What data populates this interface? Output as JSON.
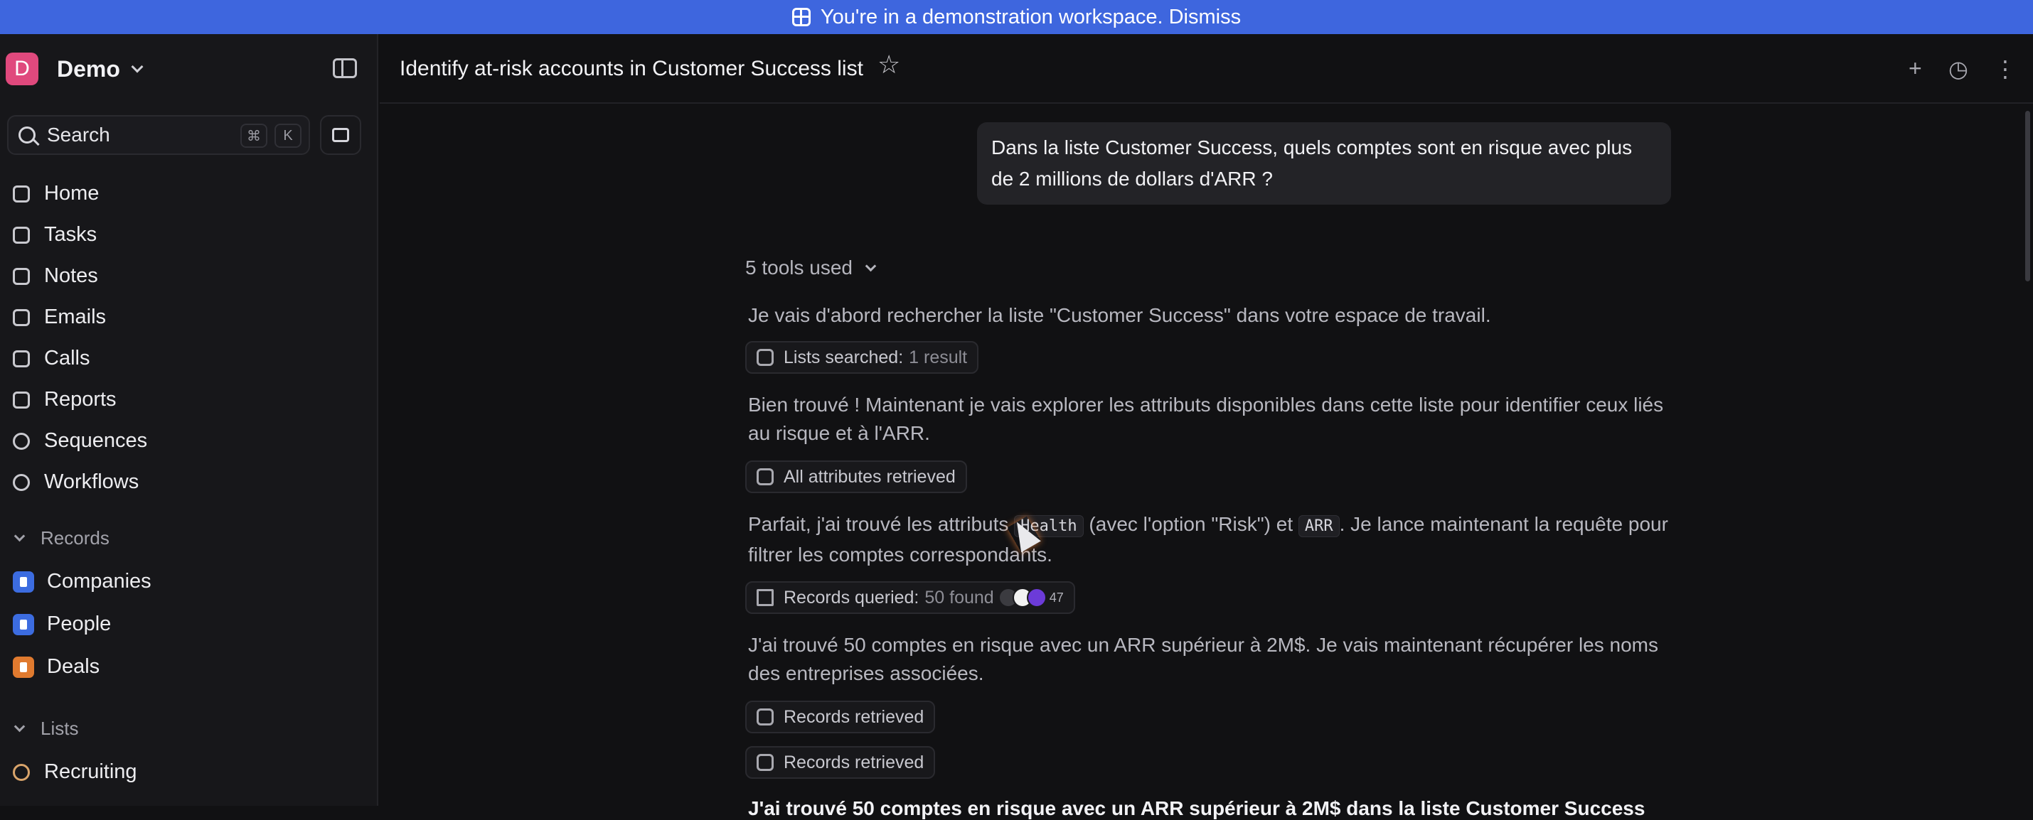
{
  "banner": {
    "text": "You're in a demonstration workspace. Dismiss"
  },
  "workspace": {
    "initial": "D",
    "name": "Demo"
  },
  "search": {
    "label": "Search",
    "shortcut_1": "⌘",
    "shortcut_2": "K"
  },
  "nav": [
    {
      "label": "Home",
      "icon": "home-icon"
    },
    {
      "label": "Tasks",
      "icon": "tasks-icon"
    },
    {
      "label": "Notes",
      "icon": "notes-icon"
    },
    {
      "label": "Emails",
      "icon": "emails-icon"
    },
    {
      "label": "Calls",
      "icon": "calls-icon"
    },
    {
      "label": "Reports",
      "icon": "reports-icon"
    },
    {
      "label": "Sequences",
      "icon": "sequences-icon"
    },
    {
      "label": "Workflows",
      "icon": "workflows-icon"
    }
  ],
  "records_section": {
    "label": "Records"
  },
  "records": [
    {
      "label": "Companies",
      "color": "#3c6ce0"
    },
    {
      "label": "People",
      "color": "#3c6ce0"
    },
    {
      "label": "Deals",
      "color": "#e07a2f"
    }
  ],
  "lists_section": {
    "label": "Lists"
  },
  "lists": [
    {
      "label": "Recruiting"
    }
  ],
  "header": {
    "title": "Identify at-risk accounts in Customer Success list"
  },
  "chat": {
    "user_message": "Dans la liste Customer Success, quels comptes sont en risque avec plus de 2 millions de dollars d'ARR ?",
    "tools_used": "5 tools used",
    "step1_text": "Je vais d'abord rechercher la liste \"Customer Success\" dans votre espace de travail.",
    "chip1_label": "Lists searched:",
    "chip1_value": "1 result",
    "step2_text": "Bien trouvé ! Maintenant je vais explorer les attributs disponibles dans cette liste pour identifier ceux liés au risque et à l'ARR.",
    "chip2_label": "All attributes retrieved",
    "step3_a": "Parfait, j'ai trouvé les attributs ",
    "step3_code1": "Health",
    "step3_b": " (avec l'option \"Risk\") et ",
    "step3_code2": "ARR",
    "step3_c": ". Je lance maintenant la requête pour filtrer les comptes correspondants.",
    "chip3_label": "Records queried:",
    "chip3_value": "50 found",
    "chip3_count": "47",
    "step4_text": "J'ai trouvé 50 comptes en risque avec un ARR supérieur à 2M$. Je vais maintenant récupérer les noms des entreprises associées.",
    "chip4_label": "Records retrieved",
    "chip5_label": "Records retrieved",
    "final_partial": "J'ai trouvé 50 comptes en risque avec un ARR supérieur à 2M$ dans la liste Customer Success"
  },
  "colors": {
    "banner": "#3e66de",
    "avatar": "#e0497d",
    "background": "#111113"
  }
}
